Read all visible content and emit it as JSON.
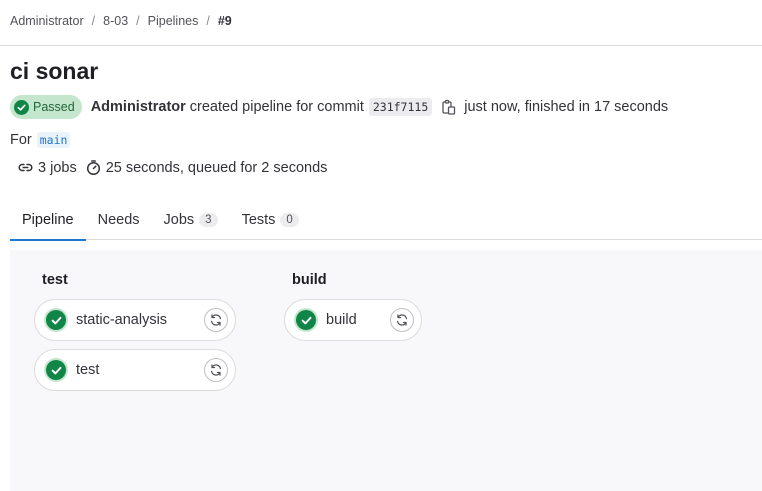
{
  "breadcrumb": {
    "items": [
      "Administrator",
      "8-03",
      "Pipelines"
    ],
    "current": "#9"
  },
  "pipeline": {
    "title": "ci sonar",
    "status": "Passed",
    "author": "Administrator",
    "created_text": "created pipeline for commit",
    "commit_sha": "231f7115",
    "finished_text": "just now, finished in 17 seconds",
    "for_label": "For",
    "ref": "main",
    "jobs_count_text": "3 jobs",
    "duration_text": "25 seconds, queued for 2 seconds"
  },
  "tabs": [
    {
      "label": "Pipeline",
      "active": true
    },
    {
      "label": "Needs"
    },
    {
      "label": "Jobs",
      "count": "3"
    },
    {
      "label": "Tests",
      "count": "0"
    }
  ],
  "stages": [
    {
      "name": "test",
      "jobs": [
        "static-analysis",
        "test"
      ]
    },
    {
      "name": "build",
      "jobs": [
        "build"
      ]
    }
  ],
  "icons": {
    "status": "check-circle-icon",
    "copy": "clipboard-icon",
    "jobs": "link-icon",
    "duration": "timer-icon",
    "retry": "retry-icon"
  },
  "colors": {
    "success": "#108548",
    "success_bg": "#c3e6cd",
    "accent": "#1f75cb"
  }
}
